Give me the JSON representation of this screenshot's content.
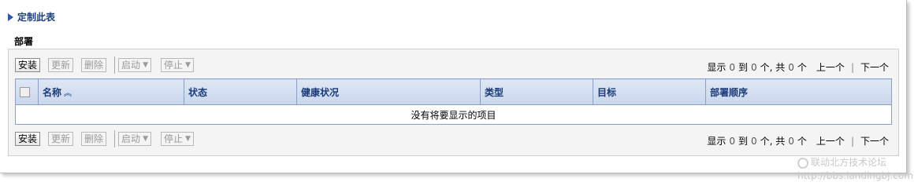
{
  "customize": {
    "label": "定制此表"
  },
  "section": {
    "title": "部署"
  },
  "toolbar": {
    "install": "安装",
    "update": "更新",
    "delete": "删除",
    "start": "启动",
    "stop": "停止"
  },
  "pager": {
    "show": "显示",
    "from": "0",
    "to_word": "到",
    "to": "0",
    "unit_total": "个, 共",
    "total": "0",
    "unit": "个",
    "prev": "上一个",
    "separator": "|",
    "next": "下一个"
  },
  "table": {
    "columns": [
      "名称",
      "状态",
      "健康状况",
      "类型",
      "目标",
      "部署顺序"
    ],
    "empty_message": "没有将要显示的项目"
  },
  "watermark": {
    "line1": "联动北方技术论坛",
    "line2": "http://bbs.landingbj.com"
  }
}
